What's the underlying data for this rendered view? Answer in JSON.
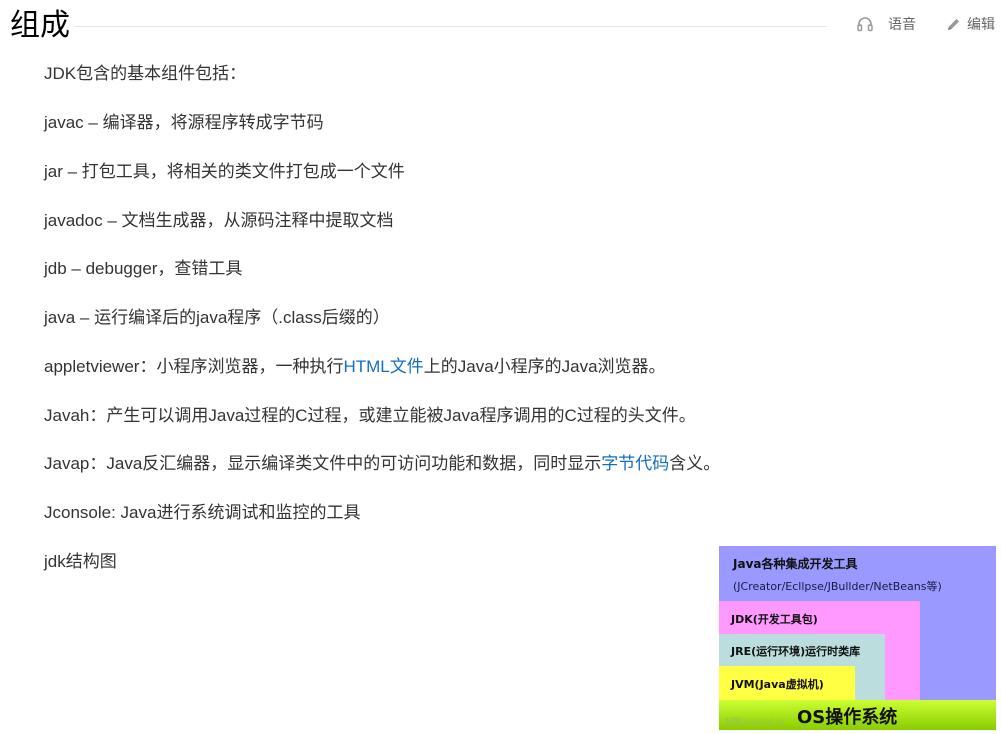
{
  "header": {
    "title": "组成",
    "voice_label": "语音",
    "edit_label": "编辑"
  },
  "intro": "JDK包含的基本组件包括：",
  "items": [
    "javac – 编译器，将源程序转成字节码",
    "jar – 打包工具，将相关的类文件打包成一个文件",
    "javadoc – 文档生成器，从源码注释中提取文档",
    "jdb – debugger，查错工具",
    "java – 运行编译后的java程序（.class后缀的）"
  ],
  "appletviewer": {
    "before": "appletviewer：小程序浏览器，一种执行",
    "link": "HTML文件",
    "after": "上的Java小程序的Java浏览器。"
  },
  "javah": "Javah：产生可以调用Java过程的C过程，或建立能被Java程序调用的C过程的头文件。",
  "javap": {
    "before": "Javap：Java反汇编器，显示编译类文件中的可访问功能和数据，同时显示",
    "link": "字节代码",
    "after": "含义。"
  },
  "jconsole": "Jconsole: Java进行系统调试和监控的工具",
  "diagram_caption": "jdk结构图",
  "diagram": {
    "ide_title": "Java各种集成开发工具",
    "ide_sub": "(JCreator/Ecllpse/JBullder/NetBeans等)",
    "jdk": "JDK(开发工具包)",
    "jre": "JRE(运行环境)运行时类库",
    "jvm": "JVM(Java虚拟机)",
    "os": "OS操作系统",
    "watermark": "制图/playkid.cn",
    "colors": {
      "ide": "#9999ff",
      "jdk": "#ff99ff",
      "jre": "#bbdddd",
      "jvm": "#ffff44",
      "os": "#99dd00"
    }
  },
  "link_color": "#136ec2"
}
